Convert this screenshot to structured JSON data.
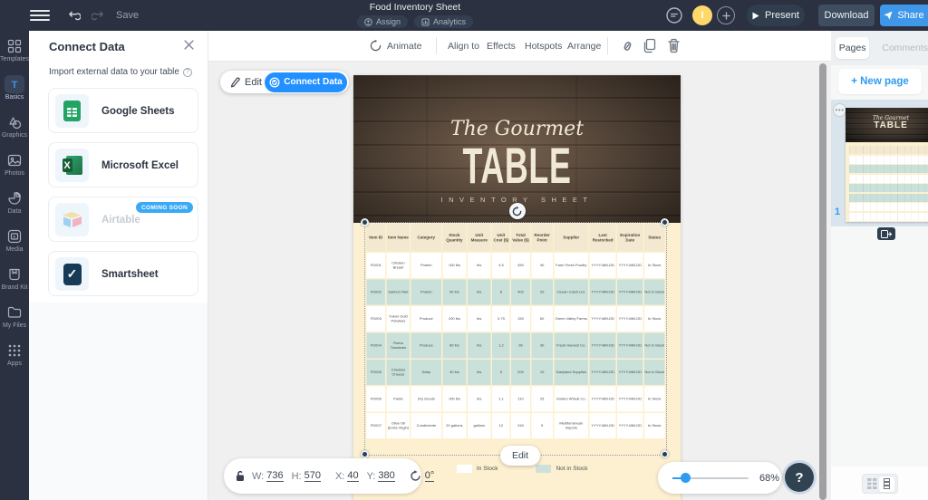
{
  "topbar": {
    "save_label": "Save",
    "title": "Food Inventory Sheet",
    "assign_label": "Assign",
    "analytics_label": "Analytics",
    "avatar_initial": "I",
    "present_label": "Present",
    "download_label": "Download",
    "share_label": "Share"
  },
  "sidebar": {
    "items": [
      {
        "id": "templates",
        "label": "Templates",
        "active": false
      },
      {
        "id": "basics",
        "label": "Basics",
        "active": true
      },
      {
        "id": "graphics",
        "label": "Graphics",
        "active": false
      },
      {
        "id": "photos",
        "label": "Photos",
        "active": false
      },
      {
        "id": "data",
        "label": "Data",
        "active": false
      },
      {
        "id": "media",
        "label": "Media",
        "active": false
      },
      {
        "id": "brand-kit",
        "label": "Brand Kit",
        "active": false
      },
      {
        "id": "my-files",
        "label": "My Files",
        "active": false
      },
      {
        "id": "apps",
        "label": "Apps",
        "active": false
      }
    ]
  },
  "connect_panel": {
    "title": "Connect Data",
    "subtitle": "Import external data to your table",
    "connectors": [
      {
        "id": "google-sheets",
        "name": "Google Sheets",
        "disabled": false,
        "badge": ""
      },
      {
        "id": "microsoft-excel",
        "name": "Microsoft Excel",
        "disabled": false,
        "badge": ""
      },
      {
        "id": "airtable",
        "name": "Airtable",
        "disabled": true,
        "badge": "COMING SOON"
      },
      {
        "id": "smartsheet",
        "name": "Smartsheet",
        "disabled": false,
        "badge": ""
      }
    ]
  },
  "toolbar": {
    "animate": "Animate",
    "align_to": "Align to",
    "effects": "Effects",
    "hotspots": "Hotspots",
    "arrange": "Arrange"
  },
  "canvas": {
    "edit_label": "Edit",
    "connect_data_label": "Connect Data",
    "design": {
      "title_script": "The Gourmet",
      "title_main": "TABLE",
      "subtitle": "INVENTORY SHEET"
    },
    "table": {
      "columns": [
        "Item ID",
        "Item Name",
        "Category",
        "Stock Quantity",
        "Unit Measure",
        "Unit Cost ($)",
        "Total Value ($)",
        "Reorder Point",
        "Supplier",
        "Last Restocked",
        "Expiration Date",
        "Status"
      ],
      "rows": [
        [
          "FD001",
          "Chicken Breast",
          "Protein",
          "100 lbs",
          "lbs",
          "4.5",
          "450",
          "40",
          "Farm Fresh Poultry",
          "YYYY-MM-DD",
          "YYYY-MM-DD",
          "In Stock"
        ],
        [
          "FD002",
          "Salmon Filet",
          "Protein",
          "50 lbs",
          "lbs",
          "8",
          "400",
          "20",
          "Ocean Catch Ltd.",
          "YYYY-MM-DD",
          "YYYY-MM-DD",
          "Not in Stock"
        ],
        [
          "FD003",
          "Yukon Gold Potatoes",
          "Produce",
          "200 lbs",
          "lbs",
          "0.75",
          "150",
          "60",
          "Green Valley Farms",
          "YYYY-MM-DD",
          "YYYY-MM-DD",
          "In Stock"
        ],
        [
          "FD004",
          "Roma Tomatoes",
          "Produce",
          "80 lbs",
          "lbs",
          "1.2",
          "96",
          "30",
          "Fresh Harvest Co.",
          "YYYY-MM-DD",
          "YYYY-MM-DD",
          "Not in Stock"
        ],
        [
          "FD005",
          "Cheddar Cheese",
          "Dairy",
          "40 lbs",
          "lbs",
          "5",
          "200",
          "10",
          "Dairyland Supplies",
          "YYYY-MM-DD",
          "YYYY-MM-DD",
          "Not in Stock"
        ],
        [
          "FD006",
          "Pasta",
          "Dry Goods",
          "100 lbs",
          "lbs",
          "1.1",
          "110",
          "25",
          "Golden Wheat Co.",
          "YYYY-MM-DD",
          "YYYY-MM-DD",
          "In Stock"
        ],
        [
          "FD007",
          "Olive Oil (Extra Virgin)",
          "Condiments",
          "20 gallons",
          "gallons",
          "12",
          "240",
          "5",
          "Mediterranean Imports",
          "YYYY-MM-DD",
          "YYYY-MM-DD",
          "In Stock"
        ]
      ],
      "status_colors": {
        "In Stock": "#ffffff",
        "Not in Stock": "#cae0db"
      }
    },
    "legend": {
      "in_stock": "In Stock",
      "not_in_stock": "Not in Stock",
      "in_color": "#ffffff",
      "out_color": "#cde0da"
    },
    "selection_edit_label": "Edit",
    "dims": {
      "w_label": "W:",
      "w": "736",
      "h_label": "H:",
      "h": "570",
      "x_label": "X:",
      "x": "40",
      "y_label": "Y:",
      "y": "380",
      "rotation": "0°"
    },
    "zoom": {
      "value": "68%"
    }
  },
  "pages_panel": {
    "tab_pages": "Pages",
    "tab_comments": "Comments",
    "new_page_label": "+ New page",
    "page_number": "1"
  },
  "colors": {
    "topbar_bg": "#2b3140",
    "accent_blue": "#2291ff",
    "canvas_bg": "#f0f0f0",
    "page_cream": "#fdf0d0",
    "table_header": "#f3e9d0",
    "row_teal": "#cae0db"
  }
}
